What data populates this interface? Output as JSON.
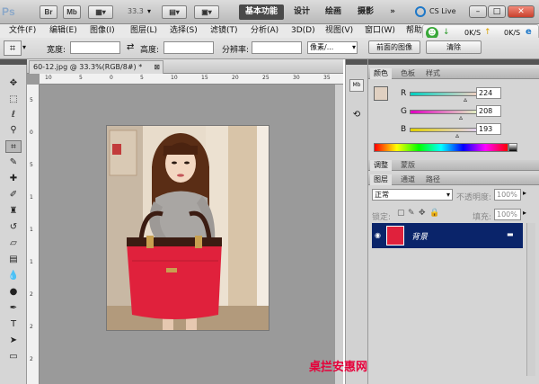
{
  "app": {
    "logo": "Ps",
    "bridge_button": "Br",
    "minibridge_button": "Mb",
    "zoom_level": "33.3",
    "workspaces": [
      "基本功能",
      "设计",
      "绘画",
      "摄影"
    ],
    "more_workspaces": "»",
    "cs_live": "CS Live"
  },
  "menubar": {
    "items": [
      "文件(F)",
      "编辑(E)",
      "图像(I)",
      "图层(L)",
      "选择(S)",
      "滤镜(T)",
      "分析(A)",
      "3D(D)",
      "视图(V)",
      "窗口(W)",
      "帮助"
    ]
  },
  "speed_widget": {
    "down": "0K/S",
    "up": "0K/S"
  },
  "options": {
    "width_label": "宽度:",
    "height_label": "高度:",
    "resolution_label": "分辨率:",
    "unit_select": "像素/...",
    "front_image_button": "前面的图像",
    "clear_button": "清除"
  },
  "document": {
    "tab_title": "60-12.jpg @ 33.3%(RGB/8#) *",
    "ruler_top": [
      "10",
      "5",
      "0",
      "5",
      "10",
      "15",
      "20",
      "25",
      "30",
      "35"
    ],
    "ruler_left": [
      "5",
      "0",
      "5",
      "1",
      "1",
      "1",
      "2",
      "2",
      "2"
    ]
  },
  "color_panel": {
    "tabs": [
      "颜色",
      "色板",
      "样式"
    ],
    "r_label": "R",
    "g_label": "G",
    "b_label": "B",
    "r_value": "224",
    "g_value": "208",
    "b_value": "193",
    "swatch_color": "#e0d0c1"
  },
  "adjust_panel": {
    "tabs": [
      "调整",
      "蒙版"
    ]
  },
  "layers_panel": {
    "tabs": [
      "图层",
      "通道",
      "路径"
    ],
    "blend_mode": "正常",
    "opacity_label": "不透明度:",
    "opacity_value": "100%",
    "lock_label": "锁定:",
    "fill_label": "填充:",
    "fill_value": "100%",
    "layer_name": "背景"
  },
  "watermark": "桌拦安惠网"
}
